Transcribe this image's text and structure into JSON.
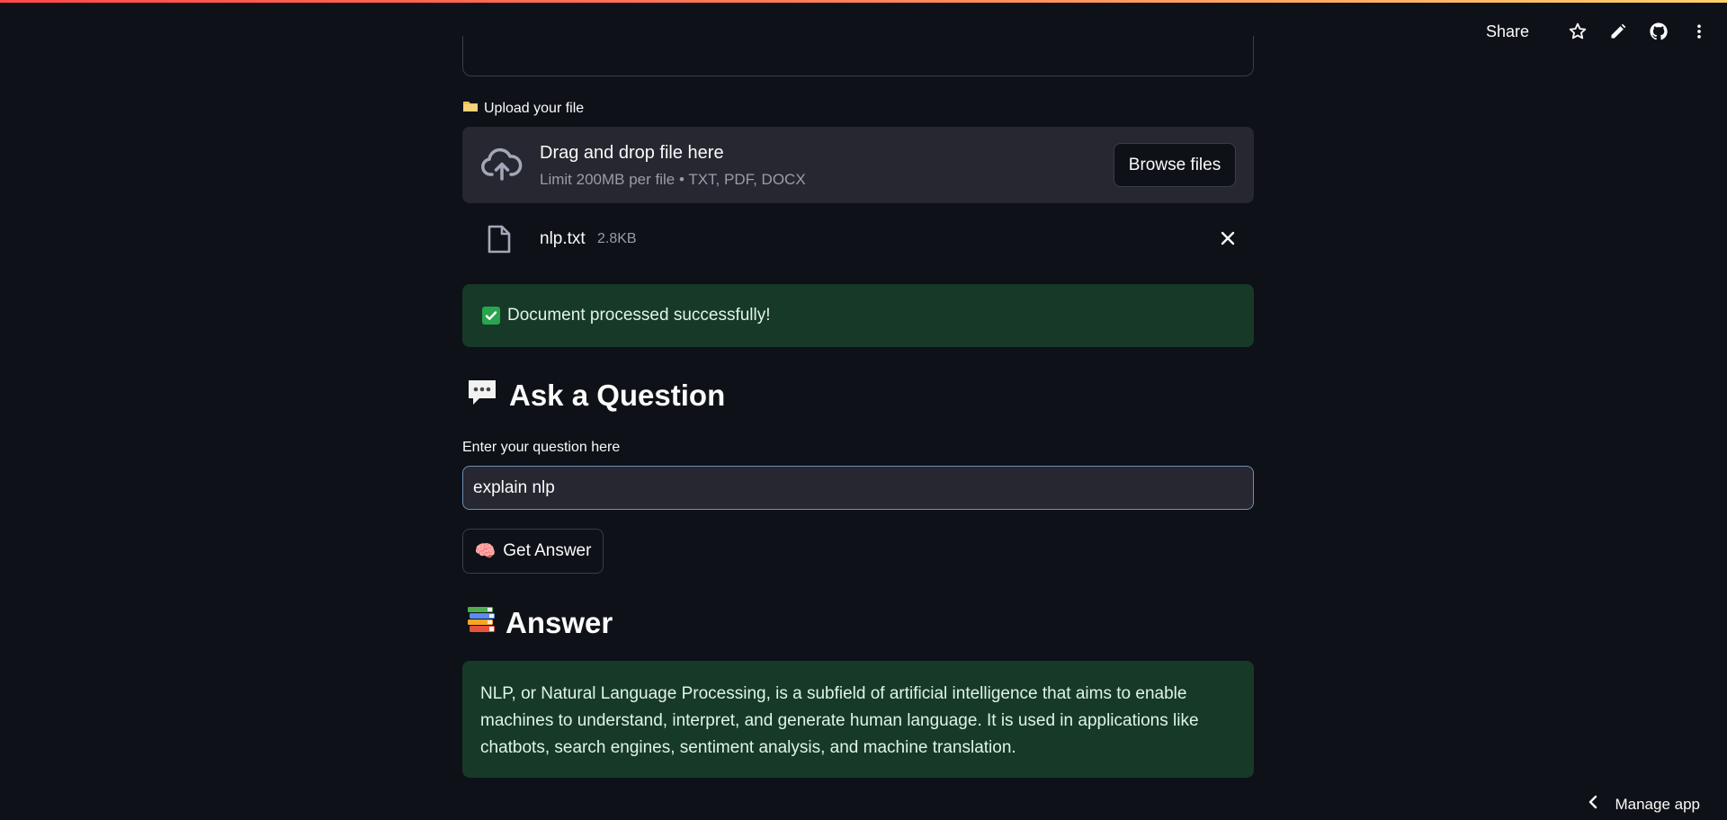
{
  "toolbar": {
    "share_label": "Share",
    "icons": [
      "star-icon",
      "edit-icon",
      "github-icon",
      "more-vert-icon"
    ]
  },
  "upload": {
    "label_icon": "folder-icon",
    "label": "Upload your file",
    "dropzone_title": "Drag and drop file here",
    "dropzone_sub": "Limit 200MB per file • TXT, PDF, DOCX",
    "browse_label": "Browse files"
  },
  "file": {
    "name": "nlp.txt",
    "size": "2.8KB"
  },
  "success": {
    "message": "Document processed successfully!"
  },
  "ask": {
    "heading": "Ask a Question",
    "input_label": "Enter your question here",
    "input_value": "explain nlp",
    "button_label": "Get Answer",
    "button_emoji": "🧠"
  },
  "answer": {
    "heading": "Answer",
    "text": "NLP, or Natural Language Processing, is a subfield of artificial intelligence that aims to enable machines to understand, interpret, and generate human language. It is used in applications like chatbots, search engines, sentiment analysis, and machine translation."
  },
  "footer": {
    "manage_label": "Manage app"
  },
  "colors": {
    "background": "#0e1117",
    "panel": "#262730",
    "success_bg": "#173928",
    "stripe_start": "#ff4b4b",
    "stripe_end": "#ffd16a"
  }
}
